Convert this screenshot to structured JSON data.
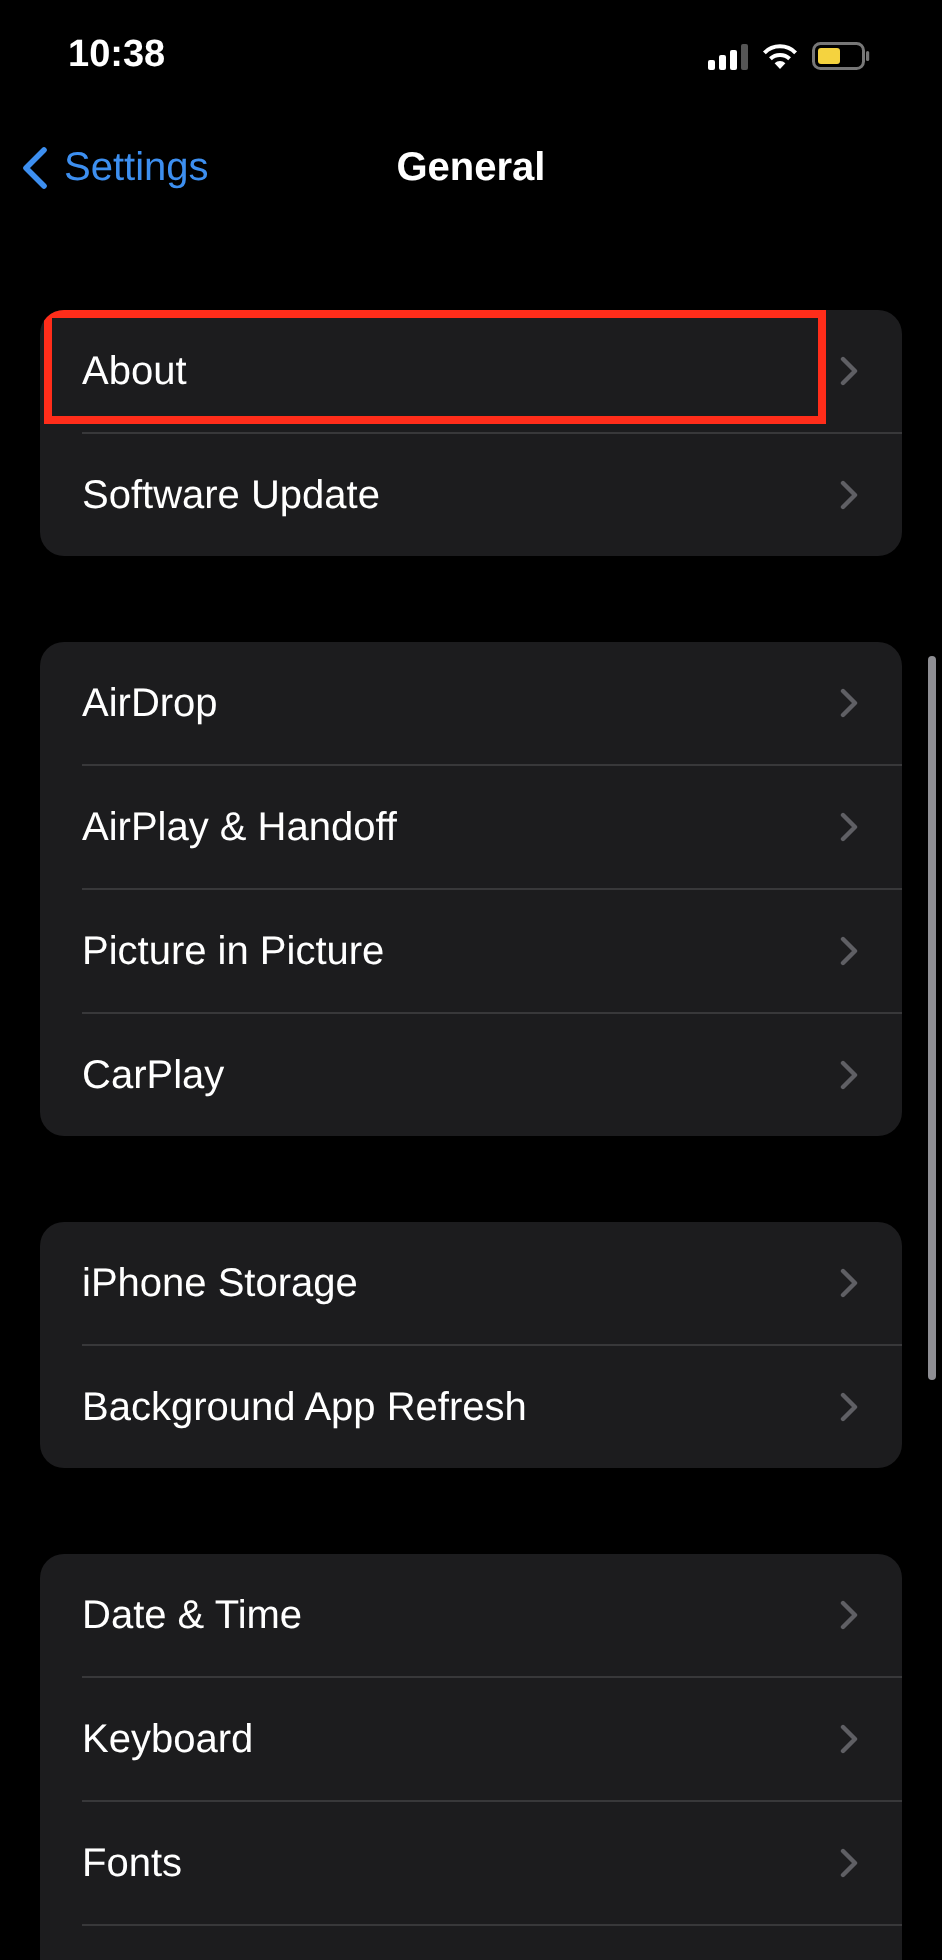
{
  "status_bar": {
    "time": "10:38"
  },
  "nav": {
    "back": "Settings",
    "title": "General"
  },
  "groups": [
    {
      "rows": [
        {
          "label": "About",
          "highlighted": true
        },
        {
          "label": "Software Update",
          "highlighted": false
        }
      ]
    },
    {
      "rows": [
        {
          "label": "AirDrop",
          "highlighted": false
        },
        {
          "label": "AirPlay & Handoff",
          "highlighted": false
        },
        {
          "label": "Picture in Picture",
          "highlighted": false
        },
        {
          "label": "CarPlay",
          "highlighted": false
        }
      ]
    },
    {
      "rows": [
        {
          "label": "iPhone Storage",
          "highlighted": false
        },
        {
          "label": "Background App Refresh",
          "highlighted": false
        }
      ]
    },
    {
      "rows": [
        {
          "label": "Date & Time",
          "highlighted": false
        },
        {
          "label": "Keyboard",
          "highlighted": false
        },
        {
          "label": "Fonts",
          "highlighted": false
        }
      ],
      "more_below": true
    }
  ]
}
